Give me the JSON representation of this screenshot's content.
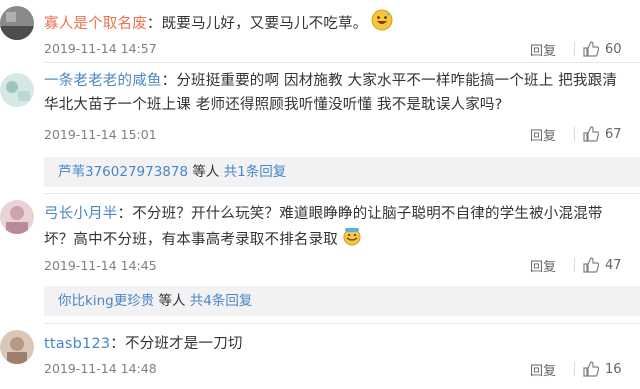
{
  "comments": [
    {
      "user": "寡人是个取名废",
      "text": "既要马儿好，又要马儿不吃草。",
      "emoji": "grinning-sweat-face",
      "time": "2019-11-14 14:57",
      "reply_label": "回复",
      "likes": "60"
    },
    {
      "user": "一条老老老的咸鱼",
      "text": "分班挺重要的啊 因材施教 大家水平不一样咋能搞一个班上 把我跟清华北大苗子一个班上课 老师还得照顾我听懂没听懂 我不是耽误人家吗?",
      "time": "2019-11-14 15:01",
      "reply_label": "回复",
      "likes": "67",
      "subreply": {
        "who": "芦苇376027973878",
        "others": "等人",
        "link": "共1条回复"
      }
    },
    {
      "user": "弓长小月半",
      "text": "不分班？开什么玩笑？难道眼睁睁的让脑子聪明不自律的学生被小混混带坏？高中不分班，有本事高考录取不排名录取",
      "emoji": "smiling-face-emoji",
      "time": "2019-11-14 14:45",
      "reply_label": "回复",
      "likes": "47",
      "subreply": {
        "who": "你比king更珍贵",
        "others": "等人",
        "link": "共4条回复"
      }
    },
    {
      "user": "ttasb123",
      "text": "不分班才是一刀切",
      "time": "2019-11-14 14:48",
      "reply_label": "回复",
      "likes": "16"
    }
  ],
  "colors": {
    "username": "#eb7350",
    "link": "#4a86c5",
    "subreply_bg": "#f2f2f5"
  }
}
